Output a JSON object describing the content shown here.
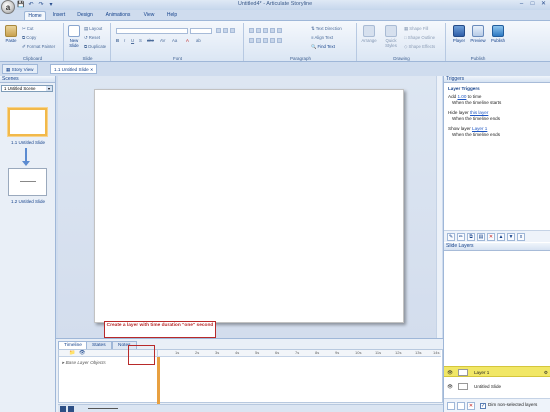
{
  "window": {
    "title": "Untitled4* - Articulate Storyline",
    "orb_label": "a"
  },
  "quick_access": [
    "save-icon",
    "undo-icon",
    "redo-icon",
    "customize-icon"
  ],
  "tabs": [
    "Home",
    "Insert",
    "Design",
    "Animations",
    "View",
    "Help"
  ],
  "ribbon": {
    "clipboard": {
      "label": "Clipboard",
      "paste": "Paste",
      "cut": "Cut",
      "copy": "Copy",
      "format_painter": "Format Painter"
    },
    "slide": {
      "label": "Slide",
      "new_slide": "New Slide",
      "layout": "Layout",
      "reset": "Reset",
      "duplicate": "Duplicate"
    },
    "font": {
      "label": "Font"
    },
    "paragraph": {
      "label": "Paragraph",
      "text_direction": "Text Direction",
      "align_text": "Align Text",
      "find_text": "Find Text"
    },
    "drawing": {
      "label": "Drawing",
      "arrange": "Arrange",
      "quick_styles": "Quick Styles",
      "shape_fill": "Shape Fill",
      "shape_outline": "Shape Outline",
      "shape_effects": "Shape Effects"
    },
    "publish": {
      "label": "Publish",
      "player": "Player",
      "preview": "Preview",
      "publish": "Publish"
    }
  },
  "doc_tabs": [
    "Story View",
    "1.1 Untitled Slide"
  ],
  "scenes": {
    "header": "Scenes",
    "selected_scene": "1 Untitled Scene",
    "slides": [
      "1.1 Untitled Slide",
      "1.2 Untitled Slide"
    ]
  },
  "triggers": {
    "header": "Triggers",
    "section": "Layer Triggers",
    "items": [
      {
        "line1_prefix": "Add ",
        "line1_link": "1.00",
        "line1_suffix": " to time",
        "line2": "When the timeline starts"
      },
      {
        "line1_prefix": "Hide layer ",
        "line1_link": "this layer",
        "line1_suffix": "",
        "line2": "When the timeline ends"
      },
      {
        "line1_prefix": "Show layer ",
        "line1_link": "Layer 1",
        "line1_suffix": "",
        "line2": "When the timeline ends"
      }
    ]
  },
  "slide_layers": {
    "header": "Slide Layers",
    "layers": [
      "Layer 1",
      "Untitled Slide"
    ],
    "dim_label": "Dim non-selected layers"
  },
  "timeline": {
    "tabs": [
      "Timeline",
      "States",
      "Notes"
    ],
    "base_layer_label": "Base Layer Objects",
    "ticks": [
      "1s",
      "2s",
      "3s",
      "4s",
      "5s",
      "6s",
      "7s",
      "8s",
      "9s",
      "10s",
      "11s",
      "12s",
      "13s",
      "14s"
    ]
  },
  "annotation": {
    "text": "Create a layer with time duration \"one\" second",
    "color": "#b82a2a"
  },
  "colors": {
    "ribbon_bg": "#dbe6f4",
    "accent": "#15428b",
    "selected_layer": "#f1e766",
    "thumbnail_select": "#f2b94a"
  }
}
